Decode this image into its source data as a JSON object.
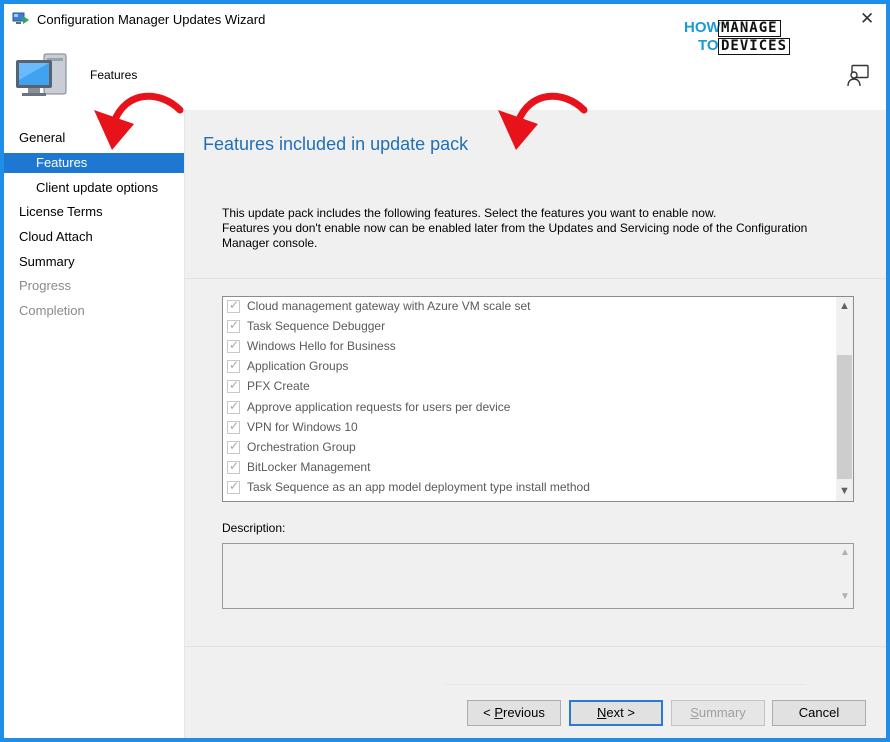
{
  "window": {
    "title": "Configuration Manager Updates Wizard",
    "close_glyph": "✕"
  },
  "logo": {
    "how": "HOW",
    "to": "TO",
    "manage": "MANAGE",
    "devices": "DEVICES",
    "color": "#1a9ad6"
  },
  "header": {
    "title": "Features"
  },
  "nav": {
    "items": [
      {
        "label": "General",
        "state": "normal"
      },
      {
        "label": "Features",
        "state": "selected"
      },
      {
        "label": "Client update options",
        "state": "normal"
      },
      {
        "label": "License Terms",
        "state": "normal"
      },
      {
        "label": "Cloud Attach",
        "state": "normal"
      },
      {
        "label": "Summary",
        "state": "normal"
      },
      {
        "label": "Progress",
        "state": "disabled"
      },
      {
        "label": "Completion",
        "state": "disabled"
      }
    ],
    "selected_color": "#1e78d2"
  },
  "content": {
    "page_title": "Features included in update pack",
    "intro_line1": "This update pack includes the following features. Select the features you want to enable now.",
    "intro_line2": "Features you don't enable now can be enabled later from the Updates and Servicing node of the Configuration Manager console.",
    "features": [
      {
        "label": "Cloud management gateway with Azure VM scale set",
        "checked": true
      },
      {
        "label": "Task Sequence Debugger",
        "checked": true
      },
      {
        "label": "Windows Hello for Business",
        "checked": true
      },
      {
        "label": "Application Groups",
        "checked": true
      },
      {
        "label": "PFX Create",
        "checked": true
      },
      {
        "label": "Approve application requests for users per device",
        "checked": true
      },
      {
        "label": "VPN for Windows 10",
        "checked": true
      },
      {
        "label": "Orchestration Group",
        "checked": true
      },
      {
        "label": "BitLocker Management",
        "checked": true
      },
      {
        "label": "Task Sequence as an app model deployment type install method",
        "checked": true
      }
    ],
    "description_label": "Description:",
    "description_value": ""
  },
  "buttons": {
    "previous": {
      "prefix": "< ",
      "accel": "P",
      "rest": "revious"
    },
    "next": {
      "accel": "N",
      "rest": "ext >"
    },
    "summary": {
      "accel": "S",
      "rest": "ummary"
    },
    "cancel": {
      "label": "Cancel"
    }
  },
  "icons": {
    "app": "wizard-app-icon",
    "header": "computer-monitor-icon",
    "feedback": "feedback-person-icon",
    "check": "checkmark-icon"
  },
  "annotation_color": "#e8121b"
}
